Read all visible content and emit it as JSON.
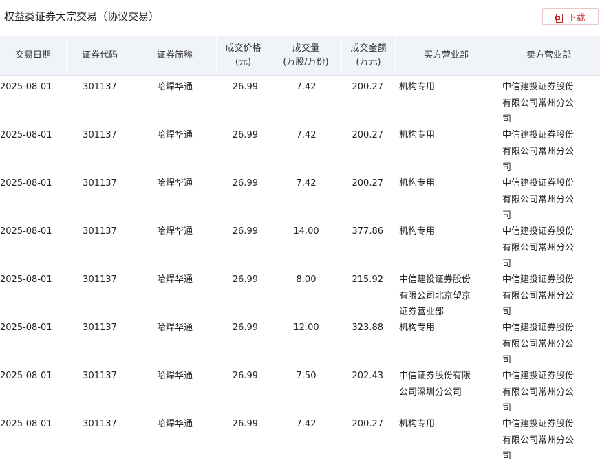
{
  "page": {
    "title": "权益类证券大宗交易（协议交易）",
    "download_label": "下载",
    "accent_color": "#cc2b2b"
  },
  "table": {
    "headers": [
      [
        "交易日期"
      ],
      [
        "证券代码"
      ],
      [
        "证券简称"
      ],
      [
        "成交价格",
        "(元)"
      ],
      [
        "成交量",
        "(万股/万份)"
      ],
      [
        "成交金额",
        "(万元)"
      ],
      [
        "买方营业部"
      ],
      [
        "卖方营业部"
      ]
    ],
    "rows": [
      {
        "date": "2025-08-01",
        "code": "301137",
        "name": "哈焊华通",
        "price": "26.99",
        "volume": "7.42",
        "amount": "200.27",
        "buyer": "机构专用",
        "seller": "中信建投证券股份有限公司常州分公司"
      },
      {
        "date": "2025-08-01",
        "code": "301137",
        "name": "哈焊华通",
        "price": "26.99",
        "volume": "7.42",
        "amount": "200.27",
        "buyer": "机构专用",
        "seller": "中信建投证券股份有限公司常州分公司"
      },
      {
        "date": "2025-08-01",
        "code": "301137",
        "name": "哈焊华通",
        "price": "26.99",
        "volume": "7.42",
        "amount": "200.27",
        "buyer": "机构专用",
        "seller": "中信建投证券股份有限公司常州分公司"
      },
      {
        "date": "2025-08-01",
        "code": "301137",
        "name": "哈焊华通",
        "price": "26.99",
        "volume": "14.00",
        "amount": "377.86",
        "buyer": "机构专用",
        "seller": "中信建投证券股份有限公司常州分公司"
      },
      {
        "date": "2025-08-01",
        "code": "301137",
        "name": "哈焊华通",
        "price": "26.99",
        "volume": "8.00",
        "amount": "215.92",
        "buyer": "中信建投证券股份有限公司北京望京证券营业部",
        "seller": "中信建投证券股份有限公司常州分公司"
      },
      {
        "date": "2025-08-01",
        "code": "301137",
        "name": "哈焊华通",
        "price": "26.99",
        "volume": "12.00",
        "amount": "323.88",
        "buyer": "机构专用",
        "seller": "中信建投证券股份有限公司常州分公司"
      },
      {
        "date": "2025-08-01",
        "code": "301137",
        "name": "哈焊华通",
        "price": "26.99",
        "volume": "7.50",
        "amount": "202.43",
        "buyer": "中信证券股份有限公司深圳分公司",
        "seller": "中信建投证券股份有限公司常州分公司"
      },
      {
        "date": "2025-08-01",
        "code": "301137",
        "name": "哈焊华通",
        "price": "26.99",
        "volume": "7.42",
        "amount": "200.27",
        "buyer": "机构专用",
        "seller": "中信建投证券股份有限公司常州分公司"
      }
    ]
  },
  "icons": {
    "download": "download-file-icon"
  }
}
